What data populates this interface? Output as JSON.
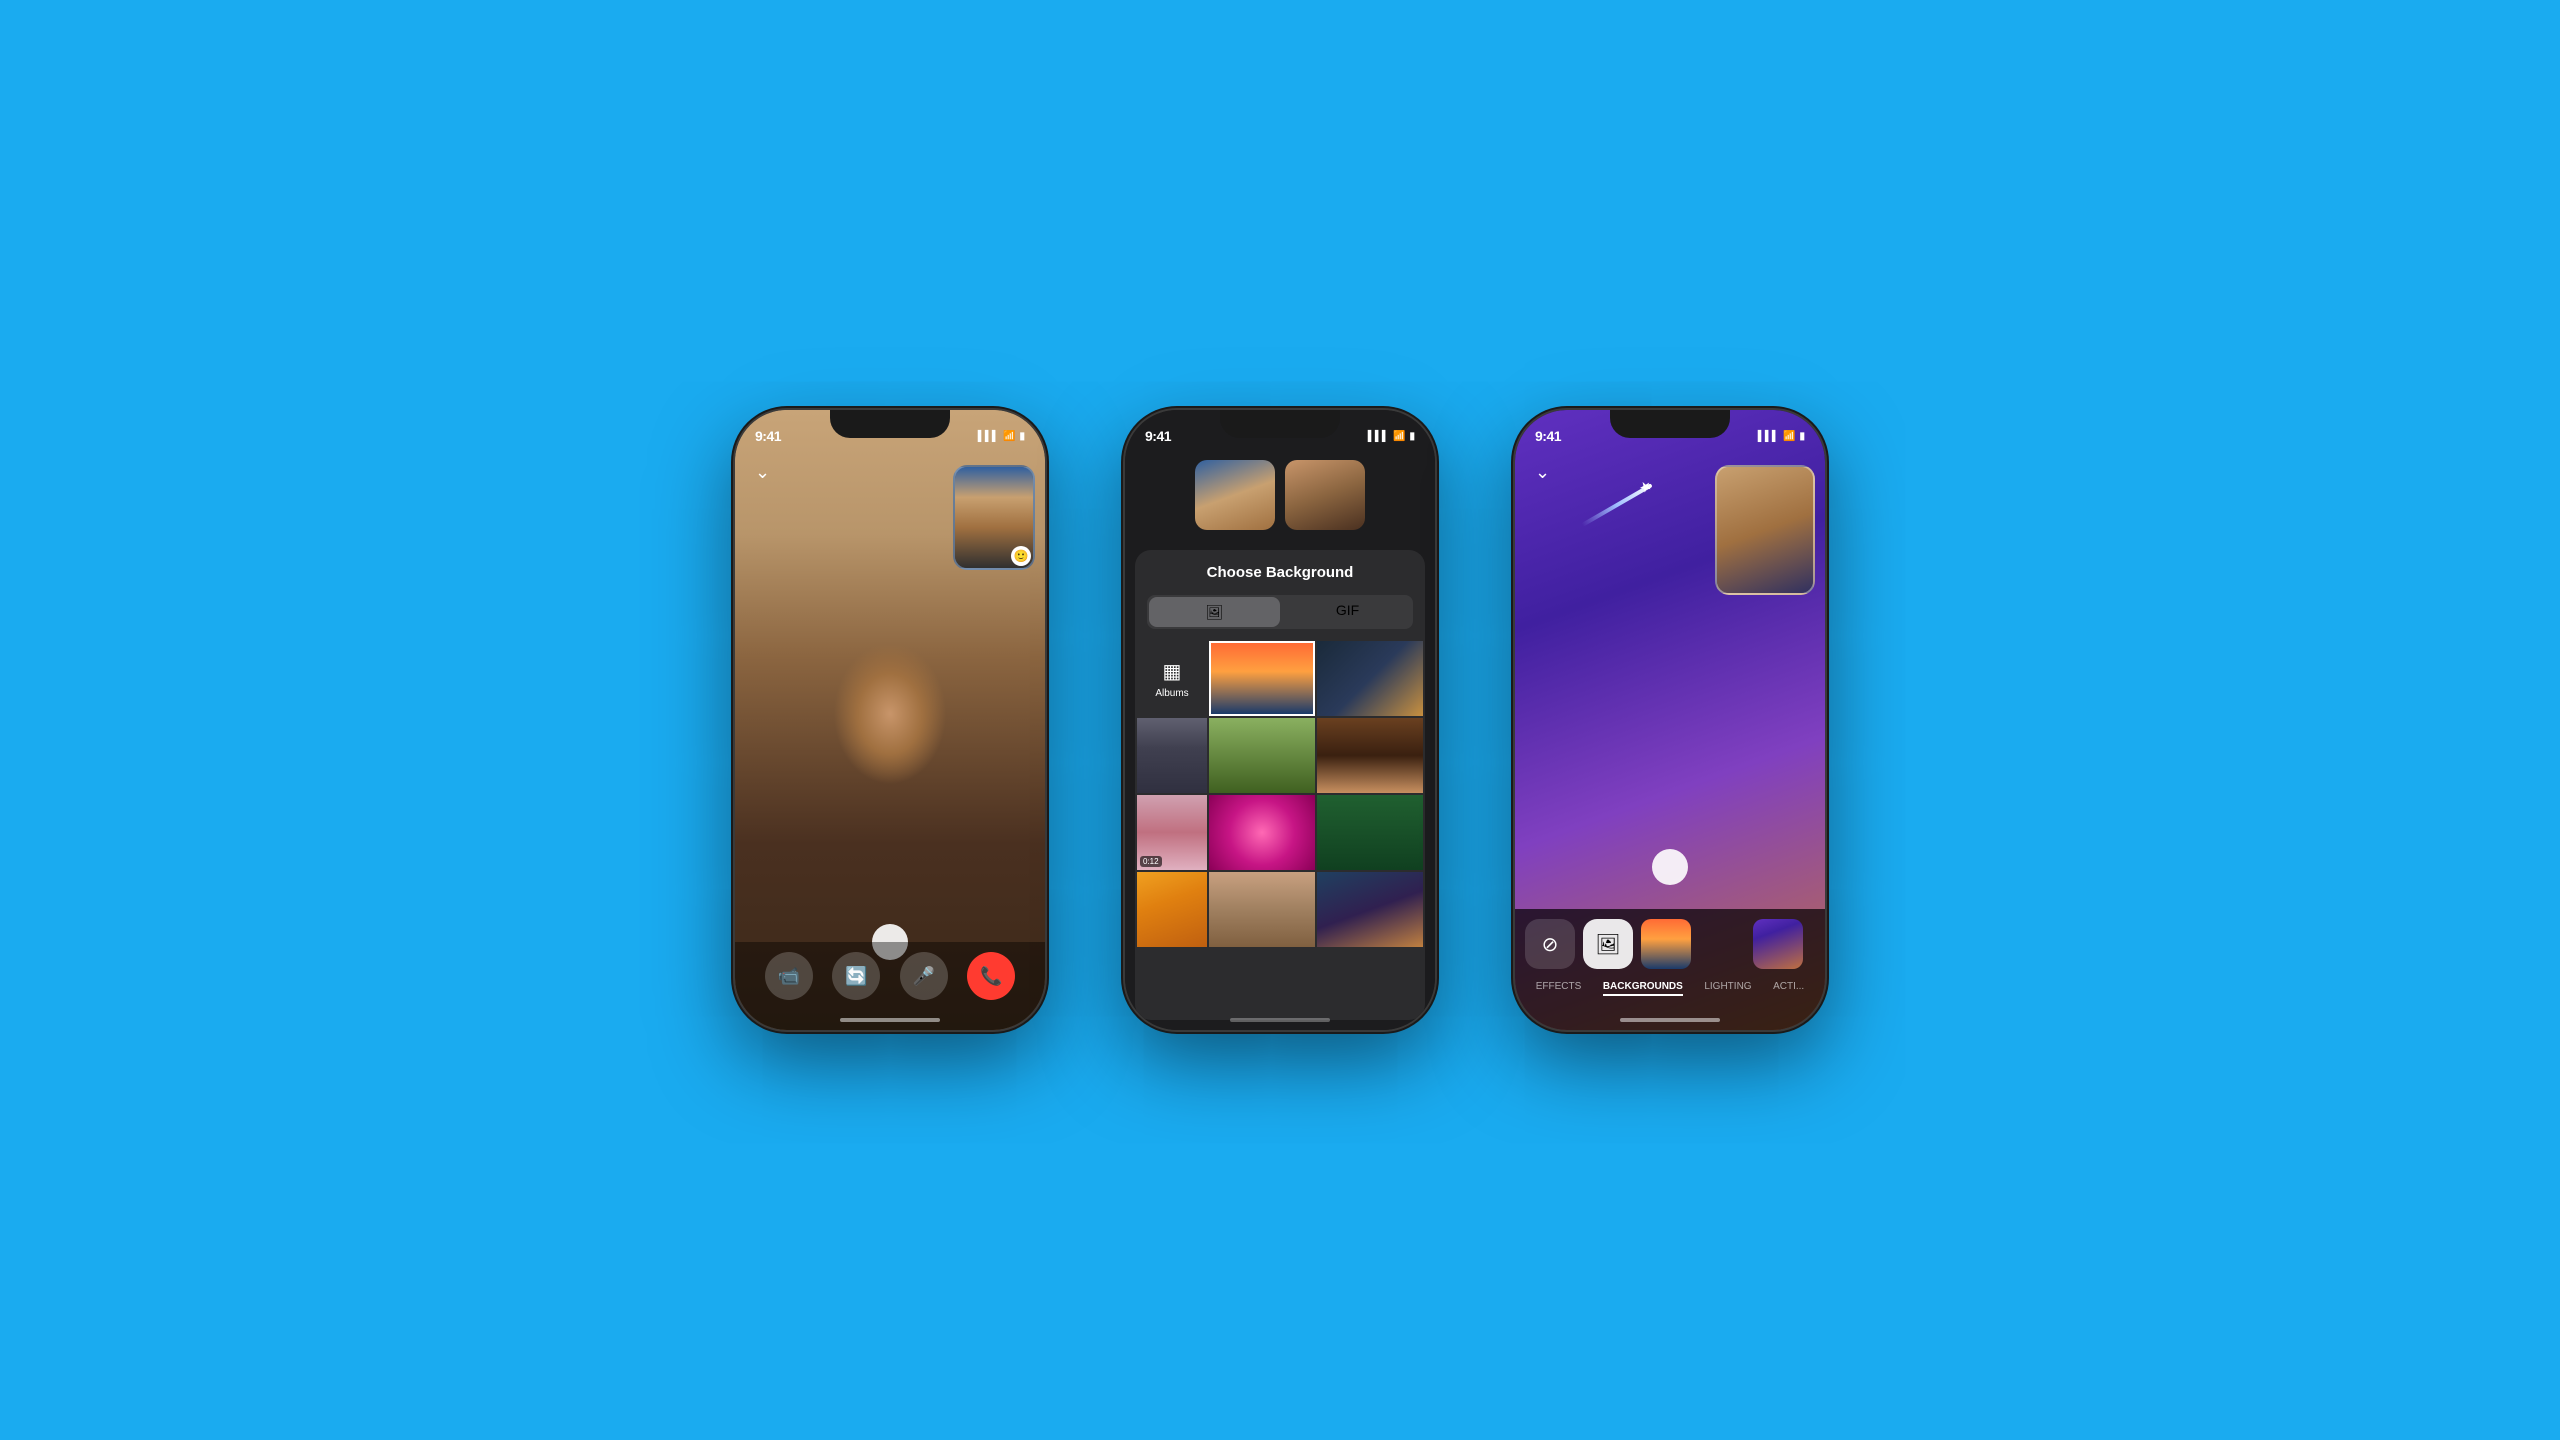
{
  "background_color": "#1AABF0",
  "phones": [
    {
      "id": "phone1",
      "type": "video_call",
      "status_bar": {
        "time": "9:41",
        "signal": "▌▌▌",
        "wifi": "WiFi",
        "battery": "🔋"
      },
      "controls": {
        "video_icon": "📹",
        "flip_icon": "🔄",
        "mic_icon": "🎤",
        "end_call_icon": "📞"
      }
    },
    {
      "id": "phone2",
      "type": "choose_background",
      "status_bar": {
        "time": "9:41",
        "signal": "▌▌▌",
        "wifi": "WiFi",
        "battery": "🔋"
      },
      "modal": {
        "title": "Choose Background",
        "tabs": [
          {
            "label": "📷",
            "active": true
          },
          {
            "label": "GIF",
            "active": false
          }
        ],
        "albums_label": "Albums",
        "video_duration": "0:12"
      }
    },
    {
      "id": "phone3",
      "type": "backgrounds_selected",
      "status_bar": {
        "time": "9:41",
        "signal": "▌▌▌",
        "wifi": "WiFi",
        "battery": "🔋"
      },
      "bottom_tabs": [
        {
          "label": "EFFECTS",
          "active": false
        },
        {
          "label": "BACKGROUNDS",
          "active": true
        },
        {
          "label": "LIGHTING",
          "active": false
        },
        {
          "label": "ACTI...",
          "active": false
        }
      ]
    }
  ]
}
